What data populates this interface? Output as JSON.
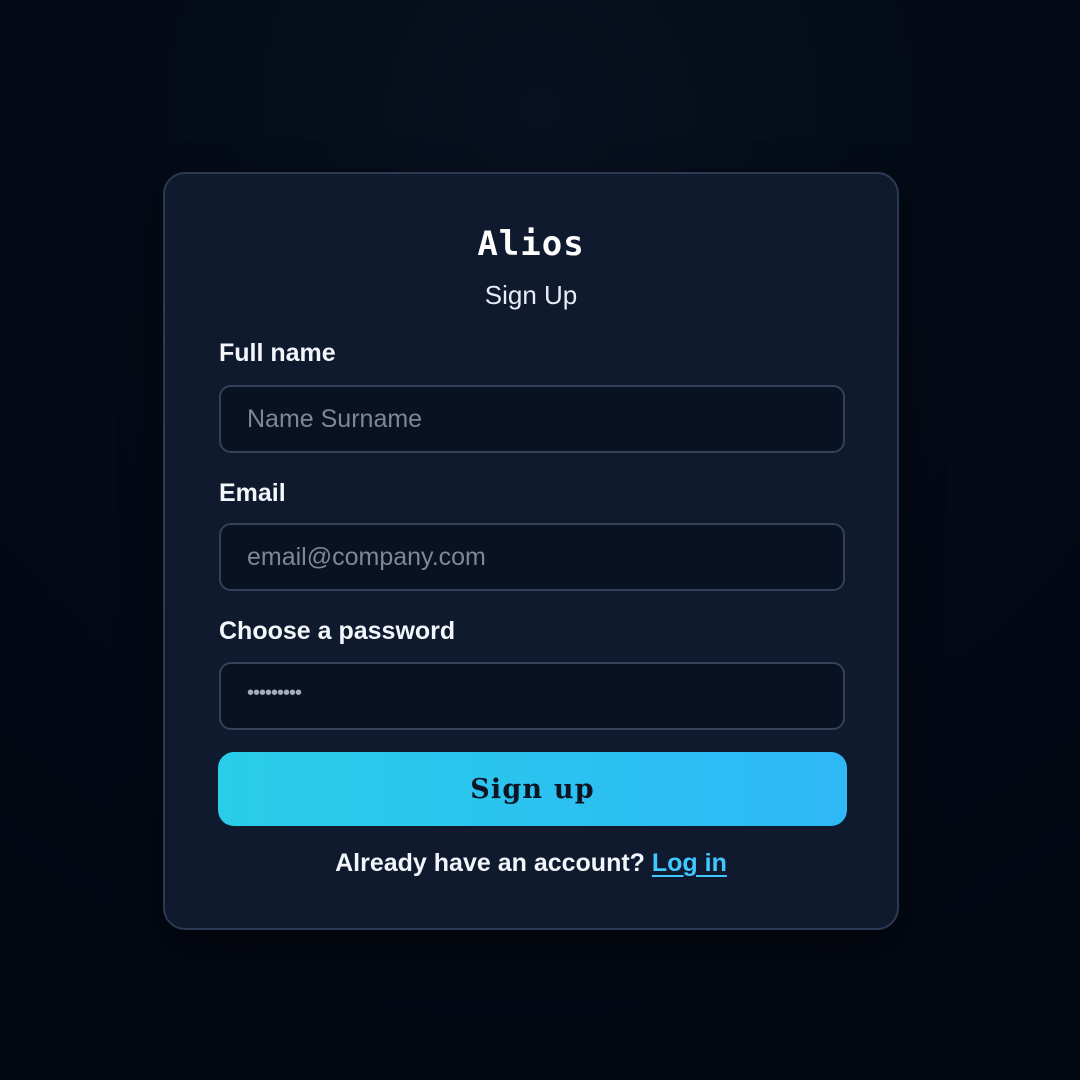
{
  "brand": "Alios",
  "subtitle": "Sign Up",
  "form": {
    "full_name_label": "Full name",
    "full_name_placeholder": "Name Surname",
    "email_label": "Email",
    "email_placeholder": "email@company.com",
    "password_label": "Choose a password",
    "password_mask": "•••••••••",
    "submit_label": "Sign up"
  },
  "footer": {
    "prompt": "Already have an account?",
    "login_link": "Log in"
  },
  "colors": {
    "accent": "#2eb8f6",
    "link": "#40c8ff"
  }
}
